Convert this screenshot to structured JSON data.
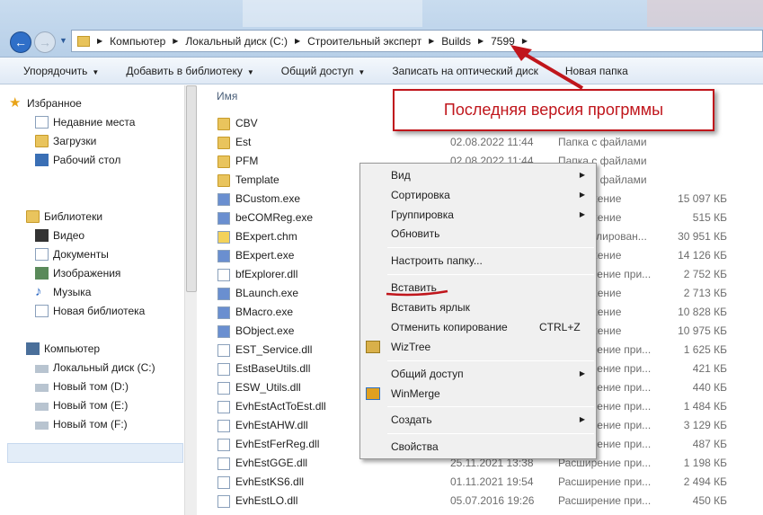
{
  "address_bar": {
    "crumbs": [
      "Компьютер",
      "Локальный диск (C:)",
      "Строительный эксперт",
      "Builds",
      "7599"
    ]
  },
  "toolbar": {
    "organize": "Упорядочить",
    "add_library": "Добавить в библиотеку",
    "share": "Общий доступ",
    "burn": "Записать на оптический диск",
    "new_folder": "Новая папка"
  },
  "nav": {
    "favorites": "Избранное",
    "recent": "Недавние места",
    "downloads": "Загрузки",
    "desktop": "Рабочий стол",
    "libraries": "Библиотеки",
    "video": "Видео",
    "documents": "Документы",
    "images": "Изображения",
    "music": "Музыка",
    "new_library": "Новая библиотека",
    "computer": "Компьютер",
    "drive_c": "Локальный диск (C:)",
    "drive_d": "Новый том (D:)",
    "drive_e": "Новый том (E:)",
    "drive_f": "Новый том (F:)"
  },
  "columns": {
    "name": "Имя"
  },
  "files": [
    {
      "name": "CBV",
      "date": "",
      "type": "",
      "size": "",
      "kind": "folder"
    },
    {
      "name": "Est",
      "date": "02.08.2022 11:44",
      "type": "Папка с файлами",
      "size": "",
      "kind": "folder"
    },
    {
      "name": "PFM",
      "date": "02.08.2022 11:44",
      "type": "Папка с файлами",
      "size": "",
      "kind": "folder"
    },
    {
      "name": "Template",
      "date": "",
      "type": "Папка с файлами",
      "size": "",
      "kind": "folder"
    },
    {
      "name": "BCustom.exe",
      "date": "",
      "type": "Приложение",
      "size": "15 097 КБ",
      "kind": "exe"
    },
    {
      "name": "beCOMReg.exe",
      "date": "",
      "type": "Приложение",
      "size": "515 КБ",
      "kind": "exe"
    },
    {
      "name": "BExpert.chm",
      "date": "",
      "type": "Скомпилирован...",
      "size": "30 951 КБ",
      "kind": "chm"
    },
    {
      "name": "BExpert.exe",
      "date": "",
      "type": "Приложение",
      "size": "14 126 КБ",
      "kind": "exe"
    },
    {
      "name": "bfExplorer.dll",
      "date": "",
      "type": "Расширение при...",
      "size": "2 752 КБ",
      "kind": "dll"
    },
    {
      "name": "BLaunch.exe",
      "date": "",
      "type": "Приложение",
      "size": "2 713 КБ",
      "kind": "exe"
    },
    {
      "name": "BMacro.exe",
      "date": "",
      "type": "Приложение",
      "size": "10 828 КБ",
      "kind": "exe"
    },
    {
      "name": "BObject.exe",
      "date": "",
      "type": "Приложение",
      "size": "10 975 КБ",
      "kind": "exe"
    },
    {
      "name": "EST_Service.dll",
      "date": "",
      "type": "Расширение при...",
      "size": "1 625 КБ",
      "kind": "dll"
    },
    {
      "name": "EstBaseUtils.dll",
      "date": "",
      "type": "Расширение при...",
      "size": "421 КБ",
      "kind": "dll"
    },
    {
      "name": "ESW_Utils.dll",
      "date": "",
      "type": "Расширение при...",
      "size": "440 КБ",
      "kind": "dll"
    },
    {
      "name": "EvhEstActToEst.dll",
      "date": "",
      "type": "Расширение при...",
      "size": "1 484 КБ",
      "kind": "dll"
    },
    {
      "name": "EvhEstAHW.dll",
      "date": "",
      "type": "Расширение при...",
      "size": "3 129 КБ",
      "kind": "dll"
    },
    {
      "name": "EvhEstFerReg.dll",
      "date": "",
      "type": "Расширение при...",
      "size": "487 КБ",
      "kind": "dll"
    },
    {
      "name": "EvhEstGGE.dll",
      "date": "25.11.2021 13:38",
      "type": "Расширение при...",
      "size": "1 198 КБ",
      "kind": "dll"
    },
    {
      "name": "EvhEstKS6.dll",
      "date": "01.11.2021 19:54",
      "type": "Расширение при...",
      "size": "2 494 КБ",
      "kind": "dll"
    },
    {
      "name": "EvhEstLO.dll",
      "date": "05.07.2016 19:26",
      "type": "Расширение при...",
      "size": "450 КБ",
      "kind": "dll"
    }
  ],
  "context_menu": {
    "view": "Вид",
    "sort": "Сортировка",
    "group": "Группировка",
    "refresh": "Обновить",
    "customize": "Настроить папку...",
    "paste": "Вставить",
    "paste_shortcut": "Вставить ярлык",
    "undo_copy": "Отменить копирование",
    "undo_shortcut": "CTRL+Z",
    "wiztree": "WizTree",
    "share": "Общий доступ",
    "winmerge": "WinMerge",
    "create": "Создать",
    "properties": "Свойства"
  },
  "annotation": {
    "callout": "Последняя версия прогрммы",
    "color": "#c0161c"
  }
}
